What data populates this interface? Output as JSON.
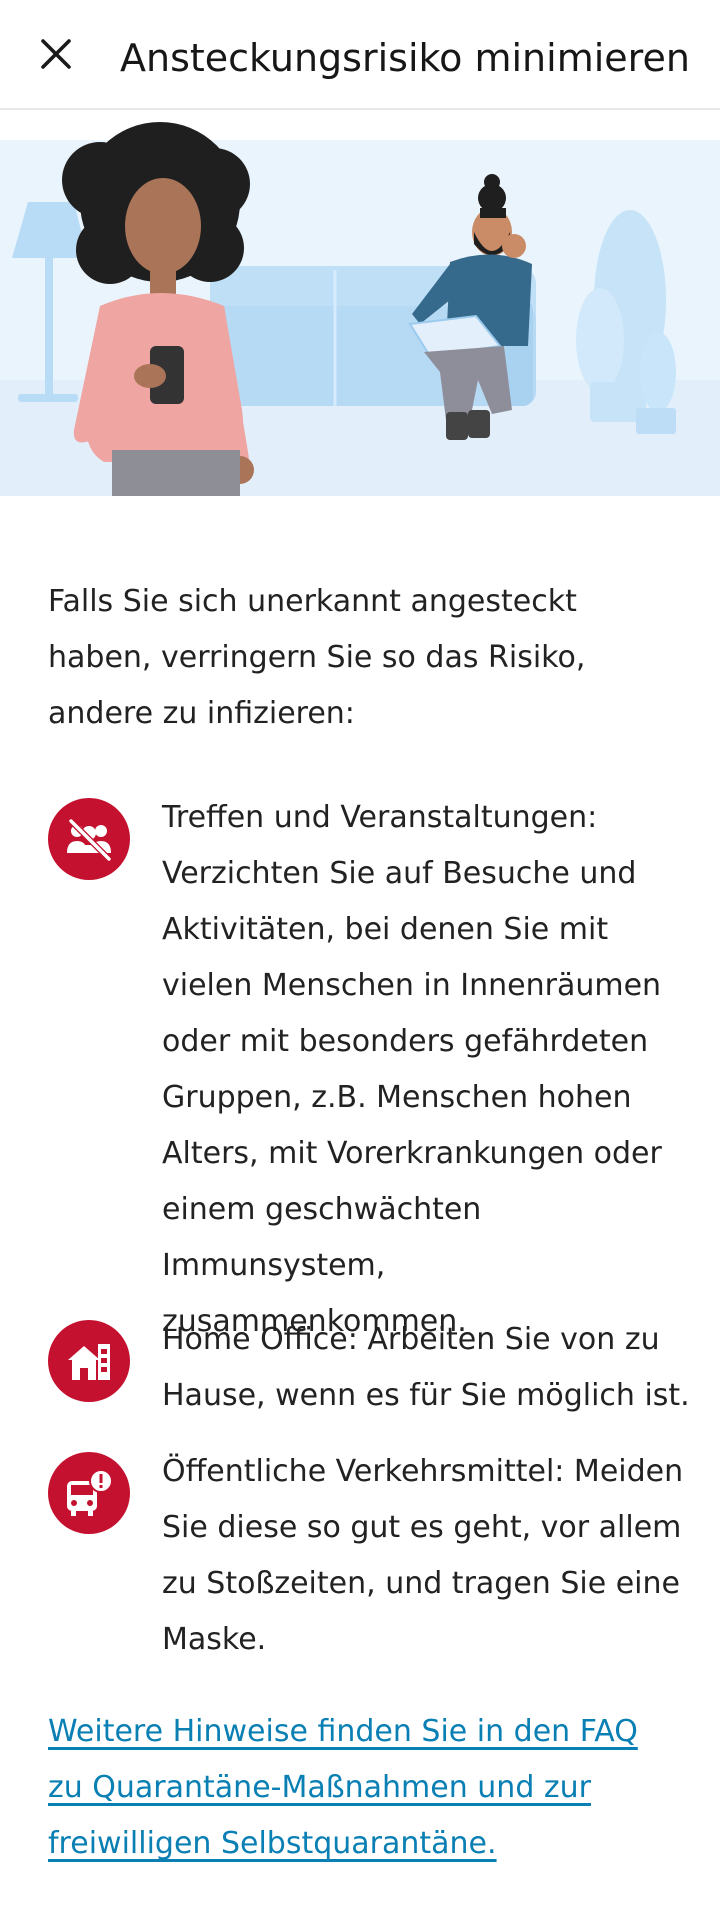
{
  "header": {
    "title": "Ansteckungsrisiko minimieren",
    "close_icon": "close-icon"
  },
  "illustration": {
    "icon": "people-at-home-illustration"
  },
  "intro": {
    "text": "Falls Sie sich unerkannt angesteckt haben, verringern Sie so das Risiko, andere zu infizieren:"
  },
  "items": [
    {
      "icon": "no-gathering-icon",
      "text": "Treffen und Veranstaltungen: Verzichten Sie auf Besuche und Aktivitäten, bei denen Sie mit vielen Menschen in Innenräumen oder mit besonders gefährdeten Gruppen, z.B. Menschen hohen Alters, mit Vorerkrankungen oder einem geschwächten Immunsystem, zusammenkommen."
    },
    {
      "icon": "home-office-icon",
      "text": "Home Office: Arbeiten Sie von zu Hause, wenn es für Sie möglich ist."
    },
    {
      "icon": "public-transport-warning-icon",
      "text": "Öffentliche Verkehrsmittel: Meiden Sie diese so gut es geht, vor allem zu Stoßzeiten, und tragen Sie eine Maske."
    }
  ],
  "faq_link": {
    "text": "Weitere Hinweise finden Sie in den FAQ zu Quarantäne-Maßnahmen und zur freiwilligen Selbstquarantäne."
  },
  "colors": {
    "accent": "#c4112f",
    "link": "#0a7fb3",
    "illustration_bg": "#e8f3fd"
  }
}
